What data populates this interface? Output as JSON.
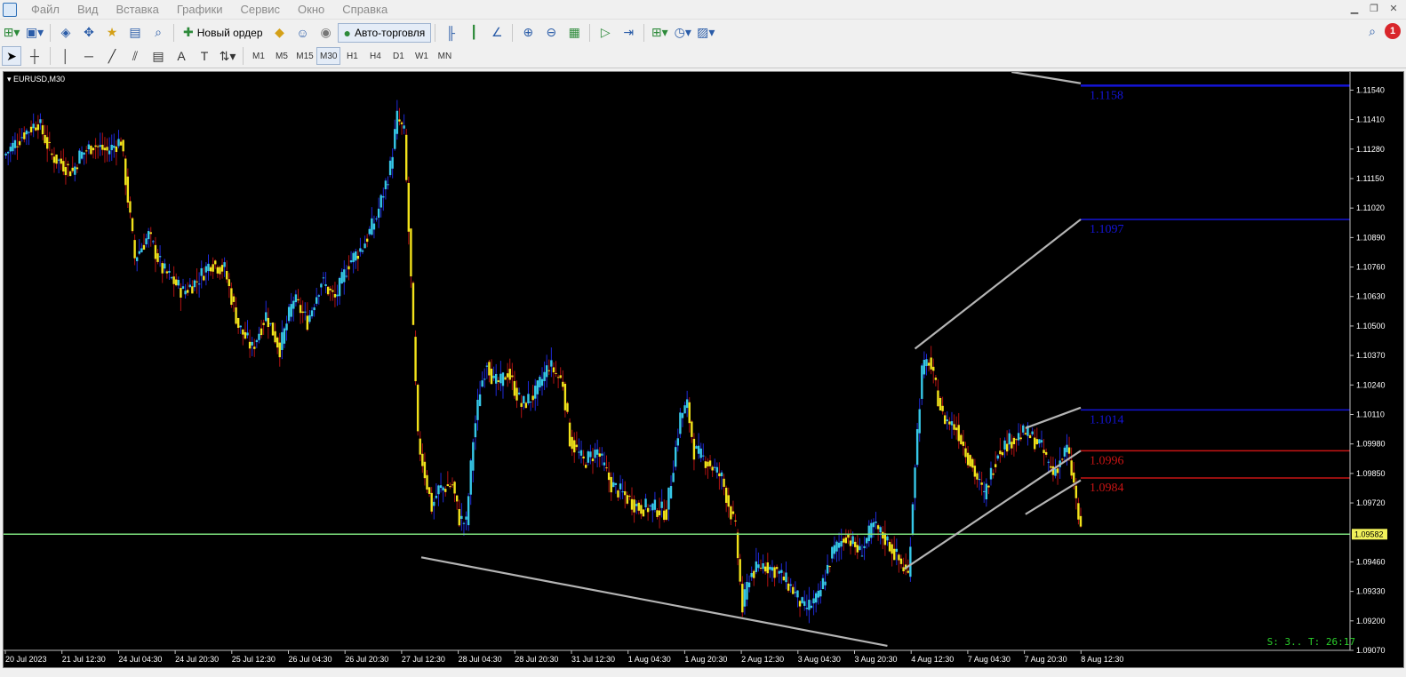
{
  "menu": [
    "Файл",
    "Вид",
    "Вставка",
    "Графики",
    "Сервис",
    "Окно",
    "Справка"
  ],
  "toolbar": {
    "new_order_label": "Новый ордер",
    "auto_trading_label": "Авто-торговля",
    "notification_count": "1"
  },
  "timeframes": [
    "M1",
    "M5",
    "M15",
    "M30",
    "H1",
    "H4",
    "D1",
    "W1",
    "MN"
  ],
  "active_timeframe": "M30",
  "chart": {
    "symbol_title": "EURUSD,M30",
    "status_text": "S: 3.. T: 26:17",
    "colors": {
      "background": "#000000",
      "bull": "#36c8e8",
      "bear": "#f2e21a",
      "wick_bull": "#1e2ad8",
      "wick_bear": "#b01212",
      "hline_blue": "#1414d8",
      "hline_red": "#c81414",
      "current_price": "#7de07d",
      "trendline": "#b4b4b4"
    }
  },
  "chart_data": {
    "type": "candlestick",
    "symbol": "EURUSD",
    "timeframe": "M30",
    "ylim": [
      1.0907,
      1.1162
    ],
    "y_ticks": [
      "1.11540",
      "1.11410",
      "1.11280",
      "1.11150",
      "1.11020",
      "1.10890",
      "1.10760",
      "1.10630",
      "1.10500",
      "1.10370",
      "1.10240",
      "1.10110",
      "1.09980",
      "1.09850",
      "1.09720",
      "1.09582",
      "1.09460",
      "1.09330",
      "1.09200",
      "1.09070"
    ],
    "x_ticks": [
      "20 Jul 2023",
      "21 Jul 12:30",
      "24 Jul 04:30",
      "24 Jul 20:30",
      "25 Jul 12:30",
      "26 Jul 04:30",
      "26 Jul 20:30",
      "27 Jul 12:30",
      "28 Jul 04:30",
      "28 Jul 20:30",
      "31 Jul 12:30",
      "1 Aug 04:30",
      "1 Aug 20:30",
      "2 Aug 12:30",
      "3 Aug 04:30",
      "3 Aug 20:30",
      "4 Aug 12:30",
      "7 Aug 04:30",
      "7 Aug 20:30",
      "8 Aug 12:30"
    ],
    "current_price": 1.09582,
    "current_price_label": "1.09582",
    "levels": [
      {
        "label": "1.1158",
        "value": 1.1156,
        "color": "blue"
      },
      {
        "label": "1.1097",
        "value": 1.1097,
        "color": "blue"
      },
      {
        "label": "1.1014",
        "value": 1.1013,
        "color": "blue"
      },
      {
        "label": "1.0996",
        "value": 1.0995,
        "color": "red"
      },
      {
        "label": "1.0984",
        "value": 1.0983,
        "color": "red"
      }
    ],
    "path": [
      [
        0,
        1.1125
      ],
      [
        3,
        1.1135
      ],
      [
        5,
        1.114
      ],
      [
        7,
        1.1125
      ],
      [
        10,
        1.1118
      ],
      [
        11,
        1.1125
      ],
      [
        13,
        1.113
      ],
      [
        15,
        1.1127
      ],
      [
        17,
        1.1132
      ],
      [
        19,
        1.108
      ],
      [
        21,
        1.109
      ],
      [
        23,
        1.1075
      ],
      [
        26,
        1.1065
      ],
      [
        28,
        1.107
      ],
      [
        30,
        1.1078
      ],
      [
        32,
        1.1075
      ],
      [
        34,
        1.105
      ],
      [
        36,
        1.104
      ],
      [
        38,
        1.1055
      ],
      [
        40,
        1.104
      ],
      [
        42,
        1.1062
      ],
      [
        44,
        1.1052
      ],
      [
        46,
        1.107
      ],
      [
        48,
        1.1062
      ],
      [
        50,
        1.1078
      ],
      [
        52,
        1.1085
      ],
      [
        54,
        1.1098
      ],
      [
        56,
        1.112
      ],
      [
        57,
        1.1142
      ],
      [
        58,
        1.1135
      ],
      [
        59,
        1.107
      ],
      [
        60,
        1.1
      ],
      [
        61,
        1.0985
      ],
      [
        62,
        1.097
      ],
      [
        63,
        1.0978
      ],
      [
        65,
        1.098
      ],
      [
        66,
        1.0965
      ],
      [
        67,
        1.0963
      ],
      [
        68,
        1.1
      ],
      [
        69,
        1.1022
      ],
      [
        70,
        1.1035
      ],
      [
        71,
        1.1025
      ],
      [
        72,
        1.1025
      ],
      [
        73,
        1.103
      ],
      [
        75,
        1.1015
      ],
      [
        77,
        1.102
      ],
      [
        79,
        1.1033
      ],
      [
        81,
        1.1025
      ],
      [
        82,
        1.1
      ],
      [
        84,
        1.099
      ],
      [
        86,
        1.0995
      ],
      [
        88,
        1.098
      ],
      [
        90,
        1.0975
      ],
      [
        92,
        1.097
      ],
      [
        94,
        1.097
      ],
      [
        96,
        1.0968
      ],
      [
        98,
        1.101
      ],
      [
        99,
        1.1015
      ],
      [
        100,
        1.0995
      ],
      [
        102,
        1.099
      ],
      [
        104,
        1.0983
      ],
      [
        106,
        1.096
      ],
      [
        107,
        1.0925
      ],
      [
        108,
        1.094
      ],
      [
        110,
        1.0945
      ],
      [
        112,
        1.0942
      ],
      [
        114,
        1.0935
      ],
      [
        116,
        1.0925
      ],
      [
        118,
        1.093
      ],
      [
        120,
        1.095
      ],
      [
        122,
        1.0958
      ],
      [
        124,
        1.095
      ],
      [
        126,
        1.0962
      ],
      [
        128,
        1.0955
      ],
      [
        130,
        1.0945
      ],
      [
        131,
        1.094
      ],
      [
        132,
        1.099
      ],
      [
        133,
        1.103
      ],
      [
        134,
        1.1035
      ],
      [
        136,
        1.101
      ],
      [
        138,
        1.1005
      ],
      [
        140,
        1.099
      ],
      [
        142,
        1.0975
      ],
      [
        144,
        1.0995
      ],
      [
        146,
        1.1
      ],
      [
        148,
        1.1003
      ],
      [
        150,
        1.0998
      ],
      [
        152,
        1.0985
      ],
      [
        154,
        1.0996
      ],
      [
        155,
        1.098
      ],
      [
        156,
        1.0958
      ]
    ],
    "trendlines": [
      {
        "from": [
          60.5,
          1.0948
        ],
        "to": [
          128,
          1.0909
        ]
      },
      {
        "from": [
          132,
          1.104
        ],
        "to": [
          156,
          1.1097
        ]
      },
      {
        "from": [
          130.5,
          1.0943
        ],
        "to": [
          156,
          1.0995
        ]
      },
      {
        "from": [
          148,
          1.0967
        ],
        "to": [
          156,
          1.0982
        ]
      },
      {
        "from": [
          148,
          1.1005
        ],
        "to": [
          156,
          1.1014
        ]
      },
      {
        "from": [
          146,
          1.1162
        ],
        "to": [
          156,
          1.1157
        ]
      }
    ]
  }
}
